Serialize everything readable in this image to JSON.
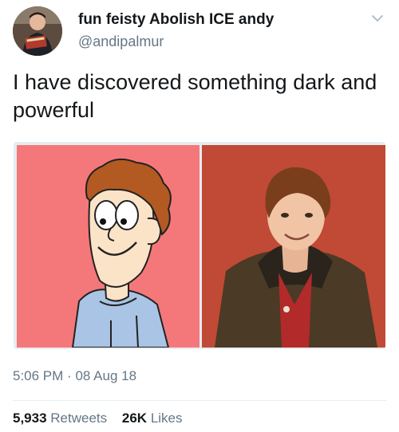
{
  "user": {
    "display_name": "fun feisty Abolish ICE andy",
    "handle": "@andipalmur"
  },
  "icons": {
    "menu": "chevron-down-icon",
    "avatar": "avatar-photo"
  },
  "tweet": {
    "text": "I have discovered something dark and powerful"
  },
  "meta": {
    "time": "5:06 PM",
    "separator": "·",
    "date": "08 Aug 18"
  },
  "stats": {
    "retweets_count": "5,933",
    "retweets_label": "Retweets",
    "likes_count": "26K",
    "likes_label": "Likes"
  },
  "colors": {
    "text_primary": "#14171a",
    "text_secondary": "#657786",
    "divider": "#e6ecf0",
    "left_panel_bg": "#f4787a",
    "right_panel_bg": "#c04a35"
  }
}
